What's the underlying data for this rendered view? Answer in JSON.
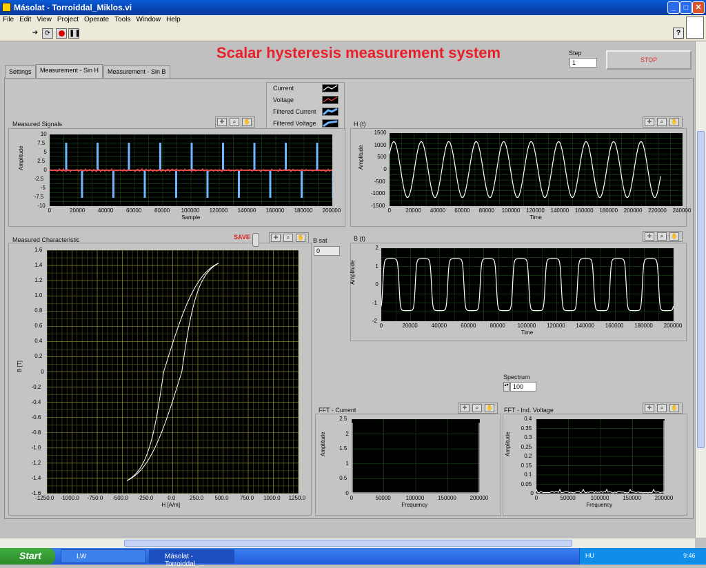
{
  "window": {
    "title": "Másolat - Torroiddal_Miklos.vi",
    "buttons": {
      "minimize": "_",
      "maximize": "□",
      "close": "✕"
    }
  },
  "menu": [
    "File",
    "Edit",
    "View",
    "Project",
    "Operate",
    "Tools",
    "Window",
    "Help"
  ],
  "panel": {
    "title": "Scalar hysteresis measurement system",
    "step_label": "Step",
    "step_value": "1",
    "stop_label": "STOP"
  },
  "tabs": [
    "Settings",
    "Measurement - Sin H",
    "Measurement - Sin B"
  ],
  "legend": [
    {
      "name": "Current",
      "color": "#ffffff"
    },
    {
      "name": "Voltage",
      "color": "#ff4040"
    },
    {
      "name": "Filtered Current",
      "color": "#6fb6ff"
    },
    {
      "name": "Filtered Voltage",
      "color": "#6fb6ff"
    }
  ],
  "save_label": "SAVE",
  "bsat": {
    "label": "B sat",
    "value": "0"
  },
  "spectrum": {
    "label": "Spectrum",
    "value": "100"
  },
  "graphs": {
    "signals": {
      "title": "Measured Signals",
      "xlabel": "Sample",
      "ylabel": "Amplitude",
      "xticks": [
        "0",
        "20000",
        "40000",
        "60000",
        "80000",
        "100000",
        "120000",
        "140000",
        "160000",
        "180000",
        "200000"
      ],
      "yticks": [
        "10",
        "7.5",
        "5",
        "2.5",
        "0",
        "-2.5",
        "-5",
        "-7.5",
        "-10"
      ]
    },
    "ht": {
      "title": "H (t)",
      "xlabel": "Time",
      "ylabel": "Amplitude",
      "xticks": [
        "0",
        "20000",
        "40000",
        "60000",
        "80000",
        "100000",
        "120000",
        "140000",
        "160000",
        "180000",
        "200000",
        "220000",
        "240000"
      ],
      "yticks": [
        "1500",
        "1000",
        "500",
        "0",
        "-500",
        "-1000",
        "-1500"
      ]
    },
    "bt": {
      "title": "B (t)",
      "xlabel": "Time",
      "ylabel": "Amplitude",
      "xticks": [
        "0",
        "20000",
        "40000",
        "60000",
        "80000",
        "100000",
        "120000",
        "140000",
        "160000",
        "180000",
        "200000"
      ],
      "yticks": [
        "2",
        "1",
        "0",
        "-1",
        "-2"
      ]
    },
    "char": {
      "title": "Measured Characteristic",
      "xlabel": "H [A/m]",
      "ylabel": "B [T]",
      "xticks": [
        "-1250.0",
        "-1000.0",
        "-750.0",
        "-500.0",
        "-250.0",
        "0.0",
        "250.0",
        "500.0",
        "750.0",
        "1000.0",
        "1250.0"
      ],
      "yticks": [
        "1.6",
        "1.4",
        "1.2",
        "1.0",
        "0.8",
        "0.6",
        "0.4",
        "0.2",
        "0",
        "-0.2",
        "-0.4",
        "-0.6",
        "-0.8",
        "-1.0",
        "-1.2",
        "-1.4",
        "-1.6"
      ]
    },
    "fftc": {
      "title": "FFT - Current",
      "xlabel": "Frequency",
      "ylabel": "Amplitude",
      "xticks": [
        "0",
        "50000",
        "100000",
        "150000",
        "200000"
      ],
      "yticks": [
        "2.5",
        "2",
        "1.5",
        "1",
        "0.5",
        "0"
      ]
    },
    "fftv": {
      "title": "FFT - Ind. Voltage",
      "xlabel": "Frequency",
      "ylabel": "Amplitude",
      "xticks": [
        "0",
        "50000",
        "100000",
        "150000",
        "200000"
      ],
      "yticks": [
        "0.4",
        "0.35",
        "0.3",
        "0.25",
        "0.2",
        "0.15",
        "0.1",
        "0.05",
        "0"
      ]
    }
  },
  "taskbar": {
    "start": "Start",
    "tasks": [
      "LW",
      "Másolat - Torroiddal_..."
    ],
    "lang": "HU",
    "clock": "9:46"
  }
}
